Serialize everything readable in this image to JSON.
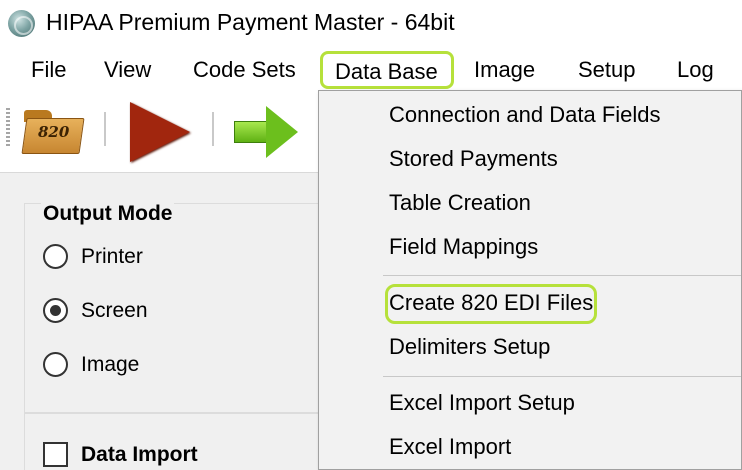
{
  "window": {
    "title": "HIPAA Premium Payment Master - 64bit",
    "icon": "app-globe-icon"
  },
  "menubar": {
    "items": [
      "File",
      "View",
      "Code Sets",
      "Data Base",
      "Image",
      "Setup",
      "Log"
    ],
    "active": "Data Base"
  },
  "toolbar": {
    "buttons": [
      {
        "name": "open-820-folder",
        "icon": "folder-icon",
        "label": "820"
      },
      {
        "name": "run",
        "icon": "play-icon"
      },
      {
        "name": "next",
        "icon": "arrow-right-icon"
      }
    ]
  },
  "output_mode": {
    "title": "Output Mode",
    "options": [
      "Printer",
      "Screen",
      "Image"
    ],
    "selected": "Screen"
  },
  "data_import": {
    "label": "Data Import",
    "checked": false
  },
  "data_base_menu": {
    "items": [
      "Connection and Data Fields",
      "Stored Payments",
      "Table Creation",
      "Field Mappings",
      "Create 820 EDI Files",
      "Delimiters Setup",
      "Excel Import Setup",
      "Excel Import"
    ],
    "highlighted": "Create 820 EDI Files"
  },
  "colors": {
    "highlight": "#b6e13b",
    "menu_bg": "#f2f2f2",
    "panel_bg": "#f0f0f0"
  }
}
